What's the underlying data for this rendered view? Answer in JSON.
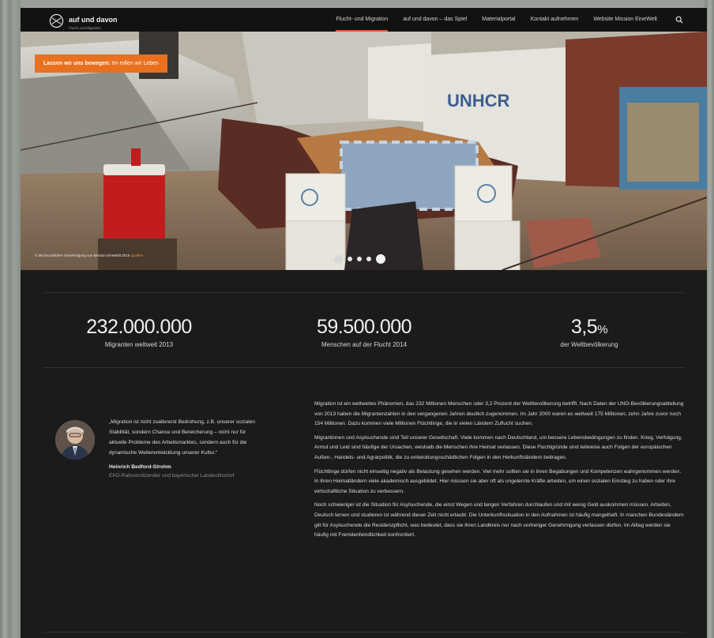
{
  "nav": {
    "logo_text": "auf und davon",
    "logo_sub": "Flucht und Migration",
    "menu": [
      "Flucht- und Migration",
      "auf und davon – das Spiel",
      "Materialportal",
      "Kontakt aufnehmen",
      "Website Mission EineWelt"
    ],
    "icons": {
      "logo": "globe-logo-icon",
      "search": "search-icon"
    }
  },
  "hero": {
    "cta_lead": "Lassen wir uns bewegen:",
    "cta_rest": "Im rollen wir Leben",
    "credit": "© Mit freundlicher Genehmigung von Mission EineWelt 2015",
    "credit_link": "Quellen",
    "slides": 5,
    "active_slide": 5
  },
  "stats": [
    {
      "value": "232.000.000",
      "unit": "",
      "label": "Migranten weltweit 2013"
    },
    {
      "value": "59.500.000",
      "unit": "",
      "label": "Menschen auf der Flucht 2014"
    },
    {
      "value": "3,5",
      "unit": "%",
      "label": "der Weltbevölkerung"
    }
  ],
  "quote": {
    "text": "„Migration ist nicht zuallererst Bedrohung, z.B. unserer sozialen Stabilität, sondern Chance und Bereicherung – nicht nur für aktuelle Probleme des Arbeitsmarktes, sondern auch für die dynamische Weiterentwicklung unserer Kultur.“",
    "name": "Heinrich Bedford-Strohm",
    "role": "EKD-Ratsvorsitzender und bayerischer Landesbischof"
  },
  "article": {
    "paragraphs": [
      "Migration ist ein weltweites Phänomen, das 232 Millionen Menschen oder 3,2 Prozent der Weltbevölkerung betrifft. Nach Daten der UNO-Bevölkerungsabteilung von 2013 haben die Migrantenzahlen in den vergangenen Jahren deutlich zugenommen. Im Jahr 2000 waren es weltweit 175 Millionen, zehn Jahre zuvor noch 154 Millionen. Dazu kommen viele Millionen Flüchtlinge, die in vielen Ländern Zuflucht suchen.",
      "Migrantinnen und Asylsuchende sind Teil unserer Gesellschaft. Viele kommen nach Deutschland, um bessere Lebensbedingungen zu finden. Krieg, Verfolgung, Armut und Leid sind häufige der Ursachen, weshalb die Menschen ihre Heimat verlassen. Diese Fluchtgründe sind teilweise auch Folgen der europäischen Außen-, Handels- und Agrarpolitik, die zu entwicklungsschädlichen Folgen in den Herkunftsländern beitragen.",
      "Flüchtlinge dürfen nicht einseitig negativ als Belastung gesehen werden. Viel mehr sollten sie in ihren Begabungen und Kompetenzen wahrgenommen werden. In ihren Heimatländern viele akademisch ausgebildet. Hier müssen sie aber oft als ungelernte Kräfte arbeiten, um einen sozialen Einstieg zu haben oder ihre wirtschaftliche Situation zu verbessern.",
      "Noch schwieriger ist die Situation für Asylsuchende, die einst Wegen und langen Verfahren durchlaufen und mit wenig Geld auskommen müssen. Arbeiten, Deutsch lernen und studieren ist während dieser Zeit nicht erlaubt. Die Unterkunftssituation in den Aufnahmen ist häufig mangelhaft. In manchen Bundesländern gilt für Asylsuchende die Residenzpflicht, was bedeutet, dass sie ihren Landkreis nur nach vorheriger Genehmigung verlassen dürfen. Im Alltag werden sie häufig mit Fremdenfeindlichkeit konfrontiert."
    ]
  },
  "colors": {
    "accent": "#e8701f",
    "nav_underline": "#e2572a",
    "background": "#1b1b1b"
  }
}
